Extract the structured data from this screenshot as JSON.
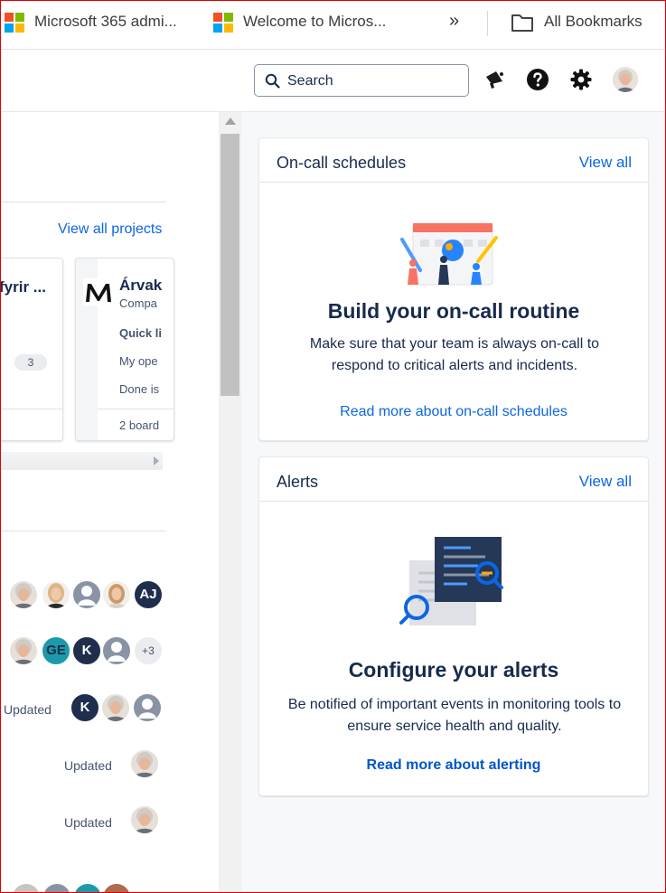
{
  "bookmarks": {
    "items": [
      {
        "label": "Microsoft 365 admi..."
      },
      {
        "label": "Welcome to Micros..."
      }
    ],
    "more": "»",
    "folder_label": "All Bookmarks"
  },
  "header": {
    "search_label": "Search"
  },
  "projects": {
    "view_all_label": "View all projects",
    "cards": [
      {
        "title": "fyrir ...",
        "count": "3"
      },
      {
        "title": "Árvak",
        "subtitle": "Compa",
        "links": [
          "Quick li",
          "My ope",
          "Done is"
        ],
        "boards": "2 board"
      }
    ]
  },
  "activity": {
    "updated_label": "Updated",
    "avatar_initials": [
      "AJ",
      "GE",
      "K",
      "+3",
      "K"
    ]
  },
  "oncall": {
    "title": "On-call schedules",
    "view_all": "View all",
    "heading": "Build your on-call routine",
    "description": "Make sure that your team is always on-call to respond to critical alerts and incidents.",
    "link": "Read more about on-call schedules"
  },
  "alerts": {
    "title": "Alerts",
    "view_all": "View all",
    "heading": "Configure your alerts",
    "description": "Be notified of important events in monitoring tools to ensure service health and quality.",
    "link": "Read more about alerting"
  },
  "colors": {
    "link": "#0c66e4",
    "text": "#172b4d",
    "avatar_navy": "#1f2e4d",
    "avatar_teal": "#1d9aaa",
    "frame": "#e00000"
  }
}
